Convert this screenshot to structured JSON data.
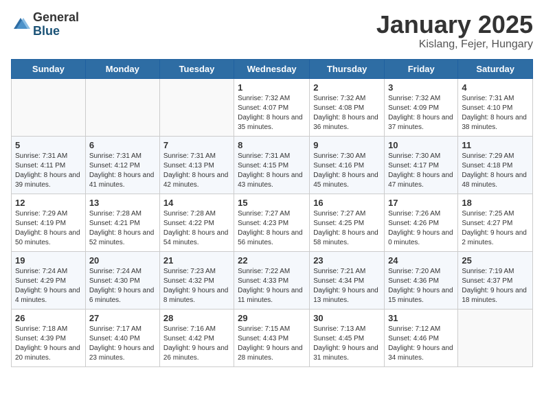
{
  "header": {
    "logo_general": "General",
    "logo_blue": "Blue",
    "month_title": "January 2025",
    "location": "Kislang, Fejer, Hungary"
  },
  "weekdays": [
    "Sunday",
    "Monday",
    "Tuesday",
    "Wednesday",
    "Thursday",
    "Friday",
    "Saturday"
  ],
  "weeks": [
    [
      {
        "day": "",
        "info": ""
      },
      {
        "day": "",
        "info": ""
      },
      {
        "day": "",
        "info": ""
      },
      {
        "day": "1",
        "info": "Sunrise: 7:32 AM\nSunset: 4:07 PM\nDaylight: 8 hours and 35 minutes."
      },
      {
        "day": "2",
        "info": "Sunrise: 7:32 AM\nSunset: 4:08 PM\nDaylight: 8 hours and 36 minutes."
      },
      {
        "day": "3",
        "info": "Sunrise: 7:32 AM\nSunset: 4:09 PM\nDaylight: 8 hours and 37 minutes."
      },
      {
        "day": "4",
        "info": "Sunrise: 7:31 AM\nSunset: 4:10 PM\nDaylight: 8 hours and 38 minutes."
      }
    ],
    [
      {
        "day": "5",
        "info": "Sunrise: 7:31 AM\nSunset: 4:11 PM\nDaylight: 8 hours and 39 minutes."
      },
      {
        "day": "6",
        "info": "Sunrise: 7:31 AM\nSunset: 4:12 PM\nDaylight: 8 hours and 41 minutes."
      },
      {
        "day": "7",
        "info": "Sunrise: 7:31 AM\nSunset: 4:13 PM\nDaylight: 8 hours and 42 minutes."
      },
      {
        "day": "8",
        "info": "Sunrise: 7:31 AM\nSunset: 4:15 PM\nDaylight: 8 hours and 43 minutes."
      },
      {
        "day": "9",
        "info": "Sunrise: 7:30 AM\nSunset: 4:16 PM\nDaylight: 8 hours and 45 minutes."
      },
      {
        "day": "10",
        "info": "Sunrise: 7:30 AM\nSunset: 4:17 PM\nDaylight: 8 hours and 47 minutes."
      },
      {
        "day": "11",
        "info": "Sunrise: 7:29 AM\nSunset: 4:18 PM\nDaylight: 8 hours and 48 minutes."
      }
    ],
    [
      {
        "day": "12",
        "info": "Sunrise: 7:29 AM\nSunset: 4:19 PM\nDaylight: 8 hours and 50 minutes."
      },
      {
        "day": "13",
        "info": "Sunrise: 7:28 AM\nSunset: 4:21 PM\nDaylight: 8 hours and 52 minutes."
      },
      {
        "day": "14",
        "info": "Sunrise: 7:28 AM\nSunset: 4:22 PM\nDaylight: 8 hours and 54 minutes."
      },
      {
        "day": "15",
        "info": "Sunrise: 7:27 AM\nSunset: 4:23 PM\nDaylight: 8 hours and 56 minutes."
      },
      {
        "day": "16",
        "info": "Sunrise: 7:27 AM\nSunset: 4:25 PM\nDaylight: 8 hours and 58 minutes."
      },
      {
        "day": "17",
        "info": "Sunrise: 7:26 AM\nSunset: 4:26 PM\nDaylight: 9 hours and 0 minutes."
      },
      {
        "day": "18",
        "info": "Sunrise: 7:25 AM\nSunset: 4:27 PM\nDaylight: 9 hours and 2 minutes."
      }
    ],
    [
      {
        "day": "19",
        "info": "Sunrise: 7:24 AM\nSunset: 4:29 PM\nDaylight: 9 hours and 4 minutes."
      },
      {
        "day": "20",
        "info": "Sunrise: 7:24 AM\nSunset: 4:30 PM\nDaylight: 9 hours and 6 minutes."
      },
      {
        "day": "21",
        "info": "Sunrise: 7:23 AM\nSunset: 4:32 PM\nDaylight: 9 hours and 8 minutes."
      },
      {
        "day": "22",
        "info": "Sunrise: 7:22 AM\nSunset: 4:33 PM\nDaylight: 9 hours and 11 minutes."
      },
      {
        "day": "23",
        "info": "Sunrise: 7:21 AM\nSunset: 4:34 PM\nDaylight: 9 hours and 13 minutes."
      },
      {
        "day": "24",
        "info": "Sunrise: 7:20 AM\nSunset: 4:36 PM\nDaylight: 9 hours and 15 minutes."
      },
      {
        "day": "25",
        "info": "Sunrise: 7:19 AM\nSunset: 4:37 PM\nDaylight: 9 hours and 18 minutes."
      }
    ],
    [
      {
        "day": "26",
        "info": "Sunrise: 7:18 AM\nSunset: 4:39 PM\nDaylight: 9 hours and 20 minutes."
      },
      {
        "day": "27",
        "info": "Sunrise: 7:17 AM\nSunset: 4:40 PM\nDaylight: 9 hours and 23 minutes."
      },
      {
        "day": "28",
        "info": "Sunrise: 7:16 AM\nSunset: 4:42 PM\nDaylight: 9 hours and 26 minutes."
      },
      {
        "day": "29",
        "info": "Sunrise: 7:15 AM\nSunset: 4:43 PM\nDaylight: 9 hours and 28 minutes."
      },
      {
        "day": "30",
        "info": "Sunrise: 7:13 AM\nSunset: 4:45 PM\nDaylight: 9 hours and 31 minutes."
      },
      {
        "day": "31",
        "info": "Sunrise: 7:12 AM\nSunset: 4:46 PM\nDaylight: 9 hours and 34 minutes."
      },
      {
        "day": "",
        "info": ""
      }
    ]
  ]
}
